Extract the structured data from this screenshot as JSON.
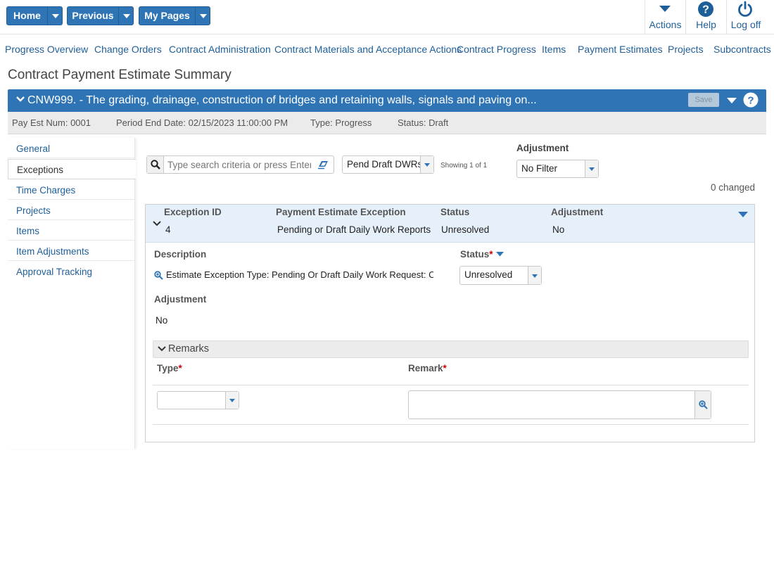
{
  "topbar": {
    "home_label": "Home",
    "previous_label": "Previous",
    "mypages_label": "My Pages",
    "actions_label": "Actions",
    "help_label": "Help",
    "logoff_label": "Log off"
  },
  "menu": [
    "Progress Overview",
    "Change Orders",
    "Contract Administration",
    "Contract Materials and Acceptance Actions",
    "Contract Progress",
    "Items",
    "Payment Estimates",
    "Projects",
    "Subcontracts"
  ],
  "page_title": "Contract Payment Estimate Summary",
  "contract": {
    "title": "CNW999. - The grading, drainage, construction of bridges and retaining walls, signals and paving on...",
    "save_label": "Save"
  },
  "info": {
    "pay_est_num": "Pay Est Num: 0001",
    "period_end": "Period End Date: 02/15/2023 11:00:00 PM",
    "type": "Type: Progress",
    "status": "Status: Draft"
  },
  "sidenav": [
    "General",
    "Exceptions",
    "Time Charges",
    "Projects",
    "Items",
    "Item Adjustments",
    "Approval Tracking"
  ],
  "toolbar": {
    "search_placeholder": "Type search criteria or press Enter",
    "pend_filter": "Pend Draft DWRs",
    "showing": "Showing 1 of 1",
    "adjustment_label": "Adjustment",
    "adjustment_value": "No Filter",
    "changed": "0 changed"
  },
  "exception": {
    "headers": {
      "id": "Exception ID",
      "exception": "Payment Estimate Exception",
      "status": "Status",
      "adjustment": "Adjustment"
    },
    "row": {
      "id": "4",
      "exception": "Pending or Draft Daily Work Reports",
      "status": "Unresolved",
      "adjustment": "No"
    },
    "detail": {
      "description_label": "Description",
      "description_value": "Estimate Exception Type: Pending Or Draft Daily Work Request: Cor",
      "status_label": "Status",
      "status_value": "Unresolved",
      "adjustment_label": "Adjustment",
      "adjustment_value": "No"
    },
    "remarks": {
      "title": "Remarks",
      "type_label": "Type",
      "remark_label": "Remark",
      "required_mark": "*"
    }
  },
  "colors": {
    "primary": "#2f75b5",
    "link": "#1f5f99",
    "required": "#cc0000"
  }
}
